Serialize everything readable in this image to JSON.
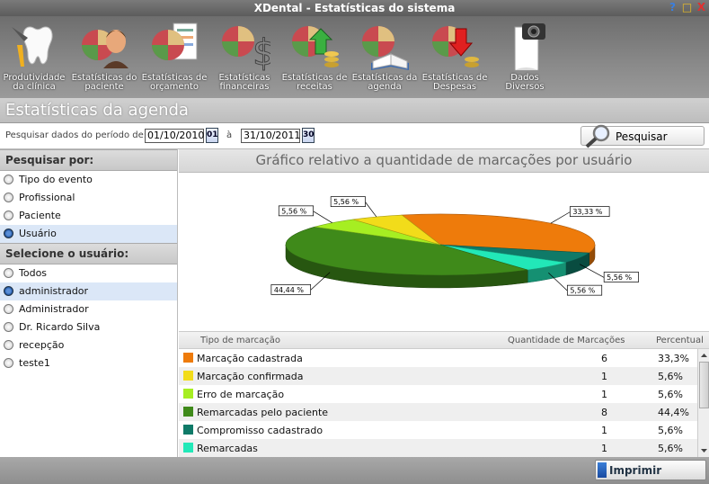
{
  "window": {
    "title": "XDental - Estatísticas do sistema",
    "controls": [
      "?",
      "□",
      "X"
    ]
  },
  "toolbar": [
    {
      "label": "Produtividade da clínica",
      "icon": "tooth-drill-icon"
    },
    {
      "label": "Estatísticas do paciente",
      "icon": "pie-chart-patient-icon"
    },
    {
      "label": "Estatísticas de orçamento",
      "icon": "pie-chart-document-icon"
    },
    {
      "label": "Estatísticas financeiras",
      "icon": "pie-chart-dollar-icon"
    },
    {
      "label": "Estatísticas de receitas",
      "icon": "pie-chart-arrow-up-coins-icon"
    },
    {
      "label": "Estatísticas da agenda",
      "icon": "pie-chart-book-icon"
    },
    {
      "label": "Estatísticas de Despesas",
      "icon": "pie-chart-arrow-down-coins-icon"
    },
    {
      "label": "Dados Diversos",
      "icon": "camera-document-icon"
    }
  ],
  "header": {
    "title": "Estatísticas da agenda"
  },
  "search": {
    "period_label": "Pesquisar dados do período de:",
    "date_from": "01/10/2010",
    "cal_from": "01",
    "sep_label": "à",
    "date_to": "31/10/2011",
    "cal_to": "30",
    "button_label": "Pesquisar"
  },
  "filter": {
    "search_by_title": "Pesquisar por:",
    "search_by_options": [
      "Tipo do evento",
      "Profissional",
      "Paciente",
      "Usuário"
    ],
    "search_by_selected": 3,
    "user_title": "Selecione o usuário:",
    "user_options": [
      "Todos",
      "administrador",
      "Administrador",
      "Dr. Ricardo Silva",
      "recepção",
      "teste1"
    ],
    "user_selected": 1
  },
  "chart_title": "Gráfico relativo a quantidade de marcações por usuário",
  "chart_data": {
    "type": "pie",
    "title": "Gráfico relativo a quantidade de marcações por usuário",
    "slices": [
      {
        "name": "Marcação cadastrada",
        "value": 6,
        "percent_label": "33,33 %",
        "color": "#ee7b0b"
      },
      {
        "name": "Compromisso cadastrado",
        "value": 1,
        "percent_label": "5,56 %",
        "color": "#0f7a68"
      },
      {
        "name": "Remarcadas",
        "value": 1,
        "percent_label": "5,56 %",
        "color": "#22e8b8"
      },
      {
        "name": "Remarcadas pelo paciente",
        "value": 8,
        "percent_label": "44,44 %",
        "color": "#3f8a1a"
      },
      {
        "name": "Erro de marcação",
        "value": 1,
        "percent_label": "5,56 %",
        "color": "#a6ee22"
      },
      {
        "name": "Marcação confirmada",
        "value": 1,
        "percent_label": "5,56 %",
        "color": "#f2dc1a"
      }
    ]
  },
  "table": {
    "headers": {
      "type": "Tipo de marcação",
      "qty": "Quantidade de Marcações",
      "pct": "Percentual"
    },
    "rows": [
      {
        "name": "Marcação cadastrada",
        "qty": "6",
        "pct": "33,3%",
        "color": "#ee7b0b"
      },
      {
        "name": "Marcação confirmada",
        "qty": "1",
        "pct": "5,6%",
        "color": "#f2dc1a"
      },
      {
        "name": "Erro de marcação",
        "qty": "1",
        "pct": "5,6%",
        "color": "#a6ee22"
      },
      {
        "name": "Remarcadas pelo paciente",
        "qty": "8",
        "pct": "44,4%",
        "color": "#3f8a1a"
      },
      {
        "name": "Compromisso cadastrado",
        "qty": "1",
        "pct": "5,6%",
        "color": "#0f7a68"
      },
      {
        "name": "Remarcadas",
        "qty": "1",
        "pct": "5,6%",
        "color": "#22e8b8"
      }
    ]
  },
  "footer": {
    "print_label": "Imprimir"
  }
}
